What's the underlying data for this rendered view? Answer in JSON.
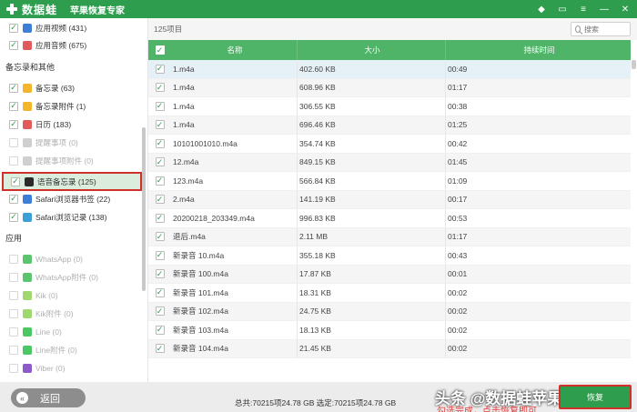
{
  "app": {
    "logo": "数据蛙",
    "title": "苹果恢复专家"
  },
  "sidebar": {
    "sections": [
      {
        "label": "备忘录和其他"
      },
      {
        "label": "应用"
      }
    ],
    "items": [
      {
        "label": "应用视频 (431)",
        "checked": true,
        "disabled": false,
        "icon": "video-icon",
        "color": "#3d7fd8"
      },
      {
        "label": "应用音频 (675)",
        "checked": true,
        "disabled": false,
        "icon": "music-icon",
        "color": "#e15b5b"
      },
      {
        "label": "备忘录 (63)",
        "checked": true,
        "disabled": false,
        "icon": "notes-icon",
        "color": "#f3b52b"
      },
      {
        "label": "备忘录附件 (1)",
        "checked": true,
        "disabled": false,
        "icon": "notes-attachment-icon",
        "color": "#f3b52b"
      },
      {
        "label": "日历 (183)",
        "checked": true,
        "disabled": false,
        "icon": "calendar-icon",
        "color": "#e15b5b"
      },
      {
        "label": "提醒事项 (0)",
        "checked": false,
        "disabled": true,
        "icon": "reminder-icon",
        "color": "#cfcfcf"
      },
      {
        "label": "提醒事项附件 (0)",
        "checked": false,
        "disabled": true,
        "icon": "reminder-attachment-icon",
        "color": "#cfcfcf"
      },
      {
        "label": "语音备忘录 (125)",
        "checked": true,
        "disabled": false,
        "selected": true,
        "icon": "voice-memo-icon",
        "color": "#2b2b2b"
      },
      {
        "label": "Safari浏览器书签 (22)",
        "checked": true,
        "disabled": false,
        "icon": "safari-bookmark-icon",
        "color": "#3d7fd8"
      },
      {
        "label": "Safari浏览记录 (138)",
        "checked": true,
        "disabled": false,
        "icon": "safari-history-icon",
        "color": "#3d9fd8"
      },
      {
        "label": "WhatsApp (0)",
        "checked": false,
        "disabled": true,
        "icon": "whatsapp-icon",
        "color": "#5cc46f"
      },
      {
        "label": "WhatsApp附件 (0)",
        "checked": false,
        "disabled": true,
        "icon": "whatsapp-attachment-icon",
        "color": "#5cc46f"
      },
      {
        "label": "Kik (0)",
        "checked": false,
        "disabled": true,
        "icon": "kik-icon",
        "color": "#9fd86f"
      },
      {
        "label": "Kik附件 (0)",
        "checked": false,
        "disabled": true,
        "icon": "kik-attachment-icon",
        "color": "#9fd86f"
      },
      {
        "label": "Line (0)",
        "checked": false,
        "disabled": true,
        "icon": "line-icon",
        "color": "#4cc764"
      },
      {
        "label": "Line附件 (0)",
        "checked": false,
        "disabled": true,
        "icon": "line-attachment-icon",
        "color": "#4cc764"
      },
      {
        "label": "Viber (0)",
        "checked": false,
        "disabled": true,
        "icon": "viber-icon",
        "color": "#8a5bc9"
      },
      {
        "label": "Viber附件 (0)",
        "checked": false,
        "disabled": true,
        "icon": "viber-attachment-icon",
        "color": "#8a5bc9"
      }
    ]
  },
  "main": {
    "count": "125项目",
    "search_placeholder": "搜索",
    "columns": [
      "名称",
      "大小",
      "持续时间"
    ],
    "rows": [
      [
        "1.m4a",
        "402.60 KB",
        "00:49"
      ],
      [
        "1.m4a",
        "608.96 KB",
        "01:17"
      ],
      [
        "1.m4a",
        "306.55 KB",
        "00:38"
      ],
      [
        "1.m4a",
        "696.46 KB",
        "01:25"
      ],
      [
        "10101001010.m4a",
        "354.74 KB",
        "00:42"
      ],
      [
        "12.m4a",
        "849.15 KB",
        "01:45"
      ],
      [
        "123.m4a",
        "566.84 KB",
        "01:09"
      ],
      [
        "2.m4a",
        "141.19 KB",
        "00:17"
      ],
      [
        "20200218_203349.m4a",
        "996.83 KB",
        "00:53"
      ],
      [
        "退后.m4a",
        "2.11 MB",
        "01:17"
      ],
      [
        "新录音 10.m4a",
        "355.18 KB",
        "00:43"
      ],
      [
        "新录音 100.m4a",
        "17.87 KB",
        "00:01"
      ],
      [
        "新录音 101.m4a",
        "18.31 KB",
        "00:02"
      ],
      [
        "新录音 102.m4a",
        "24.75 KB",
        "00:02"
      ],
      [
        "新录音 103.m4a",
        "18.13 KB",
        "00:02"
      ],
      [
        "新录音 104.m4a",
        "21.45 KB",
        "00:02"
      ]
    ]
  },
  "bottom": {
    "back_label": "返回",
    "totals": "总共:70215项24.78 GB 选定:70215项24.78 GB",
    "watermark": "头条 @数据蛙苹果恢复专家",
    "caption": "勾选完成，点击恢复即可",
    "recover_label": "恢复"
  }
}
